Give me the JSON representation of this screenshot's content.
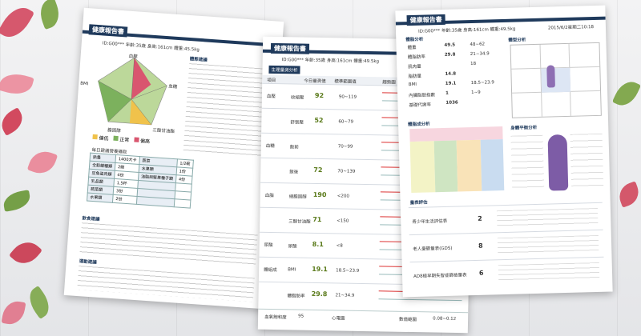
{
  "sheet1": {
    "title": "健康報告書",
    "id_line": "ID:G00*** 年齡:35歲 身高:161cm 體重:45.5kg",
    "radar_labels": {
      "top": "血壓",
      "right": "血糖",
      "bottom_right": "三酸甘油酯",
      "bottom": "膽固醇",
      "left": "BMI"
    },
    "legend": [
      "偏低",
      "正常",
      "偏高"
    ],
    "section_right": "體態建議",
    "table_title": "每日建議營養攝取",
    "table_rows": [
      [
        "熱量",
        "1400大卡",
        "蔬菜",
        "1/2碗"
      ],
      [
        "全穀雜糧類",
        "2碗",
        "水果類",
        "1份"
      ],
      [
        "豆魚蛋肉類",
        "4份",
        "油脂與堅果種子類",
        "4份"
      ],
      [
        "乳品類",
        "1.5杯",
        "",
        ""
      ],
      [
        "蔬菜類",
        "3份",
        "",
        ""
      ],
      [
        "水果類",
        "2份",
        "",
        ""
      ]
    ],
    "section_diet": "飲食建議",
    "section_exercise": "運動建議"
  },
  "sheet2": {
    "title": "健康報告書",
    "id_line": "ID:G00*** 年齡:35歲 身高:161cm 體重:49.5kg",
    "section": "生理量測分析",
    "col_headers": [
      "項目",
      "今日量測值",
      "標準範圍值",
      "趨勢圖"
    ],
    "groups": [
      "血壓",
      "血糖",
      "血脂",
      "尿酸",
      "體組成"
    ],
    "rows": [
      {
        "name": "收縮壓",
        "value": "92",
        "range": "90~119"
      },
      {
        "name": "舒張壓",
        "value": "52",
        "range": "60~79"
      },
      {
        "name": "飯前",
        "value": "",
        "range": "70~99"
      },
      {
        "name": "飯後",
        "value": "72",
        "range": "70~139"
      },
      {
        "name": "總膽固醇",
        "value": "190",
        "range": "<200"
      },
      {
        "name": "三酸甘油酯",
        "value": "71",
        "range": "<150"
      },
      {
        "name": "尿酸",
        "value": "8.1",
        "range": "<8"
      },
      {
        "name": "BMI",
        "value": "19.1",
        "range": "18.5~23.9"
      },
      {
        "name": "體脂肪率",
        "value": "29.8",
        "range": "21~34.9"
      }
    ],
    "footer": [
      "血氧飽和度",
      "95",
      "心電圖",
      "",
      "數值範圍",
      "0.08~0.12"
    ]
  },
  "sheet3": {
    "title": "健康報告書",
    "id_line": "ID:G00*** 年齡:35歲 身高:161cm 體重:49.5kg",
    "date": "2015/6/2星期二10:18",
    "section_body": "體脂分析",
    "section_type": "體型分析",
    "body_rows": [
      [
        "體重",
        "49.5",
        "48~62"
      ],
      [
        "體脂肪率",
        "29.8",
        "21~34.9"
      ],
      [
        "肌肉量",
        "",
        "18"
      ],
      [
        "脂肪量",
        "14.8",
        ""
      ],
      [
        "BMI",
        "19.1",
        "18.5~23.9"
      ],
      [
        "內臟脂肪指數",
        "1",
        "1~9"
      ],
      [
        "基礎代謝率",
        "1036",
        ""
      ]
    ],
    "section_balance": "身體平衡分析",
    "section_seg": "體脂成分析",
    "section_eval": "量表評估",
    "eval_rows": [
      {
        "name": "青少年生活評估表",
        "score": "2"
      },
      {
        "name": "老人憂鬱量表(GDS)",
        "score": "8"
      },
      {
        "name": "AD8極早期失智症篩檢量表",
        "score": "6"
      }
    ]
  }
}
